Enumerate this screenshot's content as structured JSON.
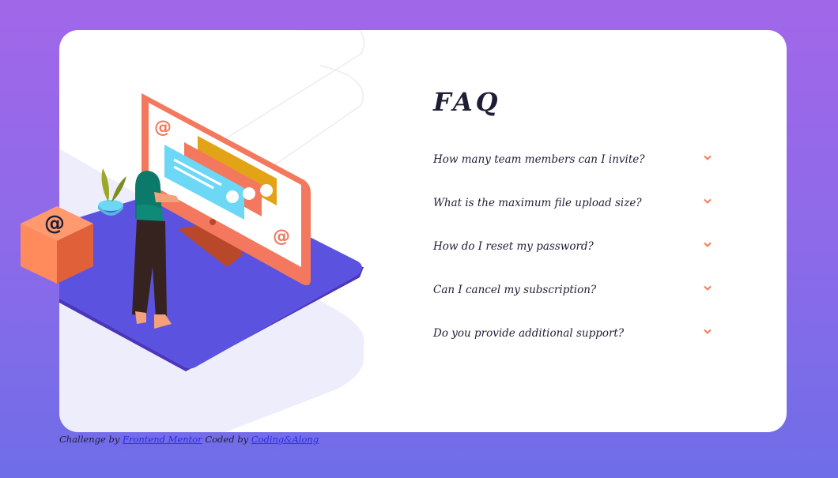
{
  "faq": {
    "title": "FAQ",
    "items": [
      {
        "question": "How many team members can I invite?"
      },
      {
        "question": "What is the maximum file upload size?"
      },
      {
        "question": "How do I reset my password?"
      },
      {
        "question": "Can I cancel my subscription?"
      },
      {
        "question": "Do you provide additional support?"
      }
    ],
    "chevron_icon": "chevron-down-icon"
  },
  "illustration": {
    "at_symbol": "@"
  },
  "attribution": {
    "prefix": "Challenge by",
    "challenge_link": "Frontend Mentor",
    "middle": "Coded by",
    "author_link": "Coding&Along"
  },
  "colors": {
    "background_top": "#a167e9",
    "background_bottom": "#6f6de8",
    "card": "#ffffff",
    "text_dark": "#1d1e35",
    "accent_orange": "#f47c57",
    "link": "#2a2af2"
  }
}
